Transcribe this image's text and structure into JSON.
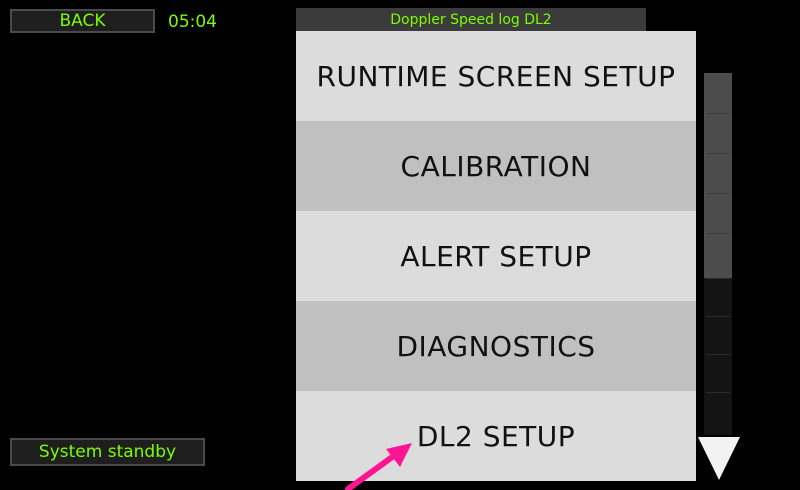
{
  "header": {
    "back_label": "BACK",
    "clock": "05:04",
    "title": "Doppler Speed log DL2"
  },
  "menu": {
    "items": [
      {
        "label": "RUNTIME SCREEN SETUP"
      },
      {
        "label": "CALIBRATION"
      },
      {
        "label": "ALERT SETUP"
      },
      {
        "label": "DIAGNOSTICS"
      },
      {
        "label": "DL2 SETUP"
      }
    ]
  },
  "status": {
    "text": "System standby"
  },
  "icons": {
    "scroll_down": "triangle-down-icon",
    "annotation": "pink-arrow-icon"
  },
  "colors": {
    "text_green": "#7cfc00",
    "menu_light": "#dcdcdc",
    "menu_dark": "#c0c0c0",
    "annotation_pink": "#ff1493"
  }
}
